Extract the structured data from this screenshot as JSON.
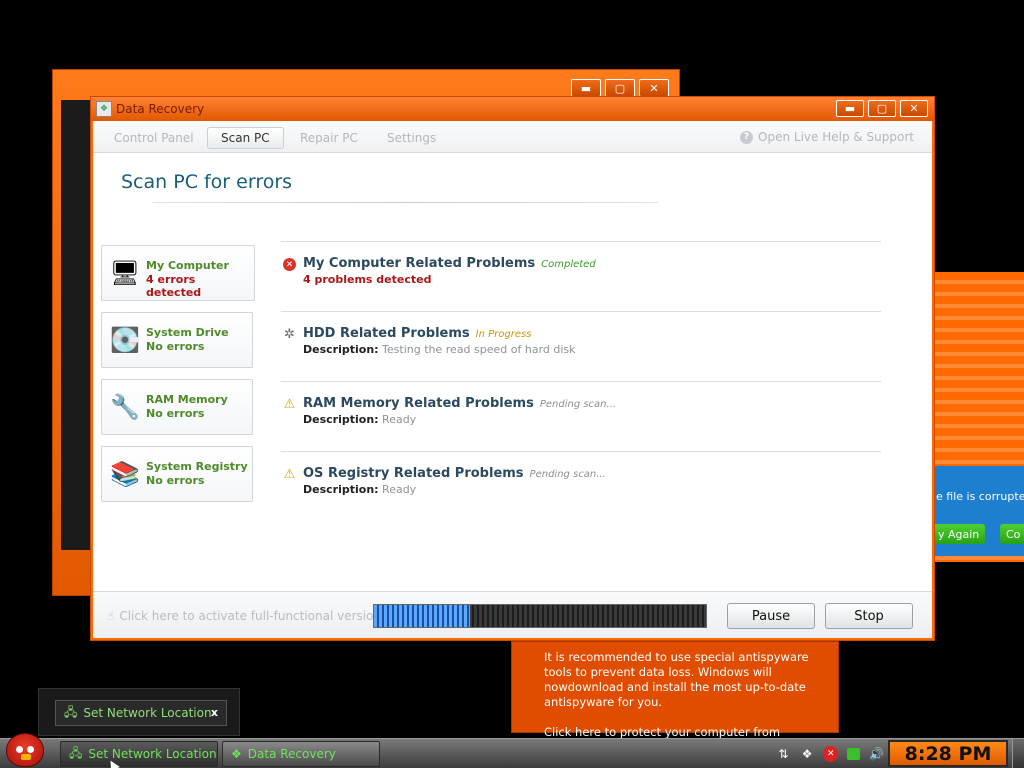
{
  "main_window": {
    "title": "Data Recovery",
    "buttons": {
      "minimize": "▬",
      "maximize": "▢",
      "close": "✕"
    }
  },
  "bg_window": {
    "buttons": {
      "minimize": "▬",
      "maximize": "▢",
      "close": "✕"
    }
  },
  "bg_right": {
    "text": "e file is corrupted o",
    "btn_try": "y Again",
    "btn_cont": "Co"
  },
  "tabs": [
    {
      "label": "Control Panel",
      "active": false
    },
    {
      "label": "Scan PC",
      "active": true
    },
    {
      "label": "Repair PC",
      "active": false
    },
    {
      "label": "Settings",
      "active": false
    }
  ],
  "help_link": "Open Live Help & Support",
  "page_title": "Scan PC for errors",
  "side_items": [
    {
      "name": "My Computer",
      "status": "4 errors detected",
      "icon": "computer-icon"
    },
    {
      "name": "System Drive",
      "status": "No errors",
      "icon": "drive-icon"
    },
    {
      "name": "RAM Memory",
      "status": "No errors",
      "icon": "ram-icon"
    },
    {
      "name": "System Registry",
      "status": "No errors",
      "icon": "registry-icon"
    }
  ],
  "problems": [
    {
      "title": "My Computer Related Problems",
      "state": "Completed",
      "detail": "4 problems detected",
      "status_icon": "error-icon"
    },
    {
      "title": "HDD Related Problems",
      "state": "In Progress",
      "desc_label": "Description:",
      "desc_value": "Testing the read speed of hard disk",
      "status_icon": "spinner-icon"
    },
    {
      "title": "RAM Memory Related Problems",
      "state": "Pending scan...",
      "desc_label": "Description:",
      "desc_value": "Ready",
      "status_icon": "warning-icon"
    },
    {
      "title": "OS Registry Related Problems",
      "state": "Pending scan...",
      "desc_label": "Description:",
      "desc_value": "Ready",
      "status_icon": "warning-icon"
    }
  ],
  "footer": {
    "activate_text": "Click here to activate full-functional version",
    "progress_percent": 29,
    "pause_label": "Pause",
    "stop_label": "Stop"
  },
  "popup": {
    "message": "It is recommended to use special antispyware tools to prevent data loss. Windows will nowdownload and install the most up-to-date antispyware for you.",
    "link": "Click here to protect your computer from spyware!"
  },
  "notification": {
    "text": "Set Network Location",
    "close": "x"
  },
  "taskbar": {
    "tasks": [
      {
        "label": "Set Network Location"
      },
      {
        "label": "Data Recovery"
      }
    ],
    "clock": "8:28 PM"
  },
  "colors": {
    "window_orange": "#ff6a00",
    "title_teal": "#1b5e79",
    "ok_green": "#4e8a2a",
    "error_red": "#a91818",
    "clock_orange": "#ff8a1a"
  }
}
